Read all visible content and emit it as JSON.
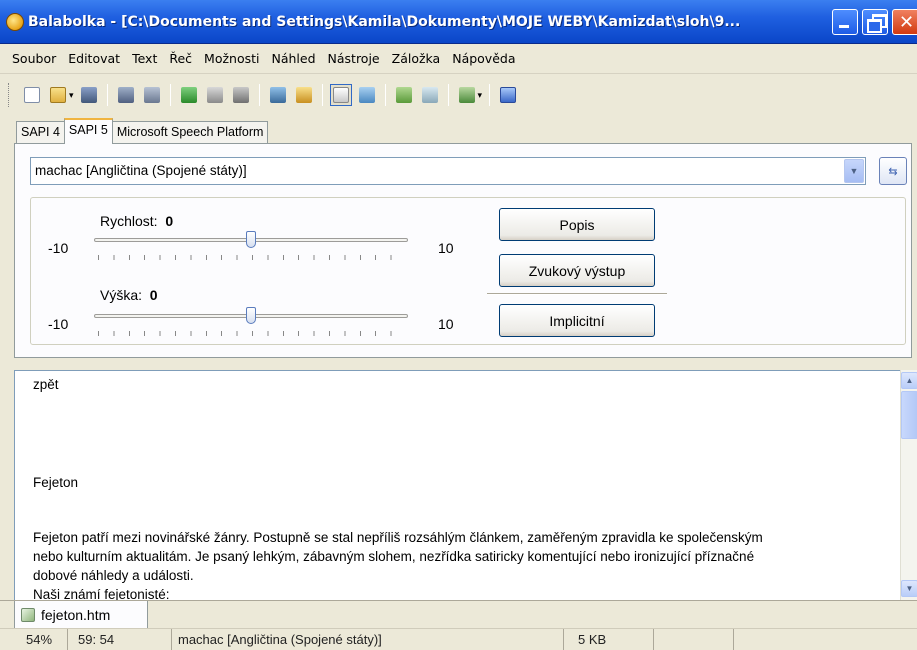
{
  "window": {
    "title": "Balabolka - [C:\\Documents and Settings\\Kamila\\Dokumenty\\MOJE WEBY\\Kamizdat\\sloh\\9...",
    "icon": "balabolka-app-icon"
  },
  "menu": [
    "Soubor",
    "Editovat",
    "Text",
    "Řeč",
    "Možnosti",
    "Náhled",
    "Nástroje",
    "Záložka",
    "Nápověda"
  ],
  "toolbar": {
    "icons": [
      "new-document-icon",
      "open-folder-icon",
      "save-icon",
      "read-aloud-icon",
      "read-clipboard-icon",
      "play-icon",
      "pause-icon",
      "stop-icon",
      "save-audio-icon",
      "open-audio-folder-icon",
      "options-icon",
      "voice-settings-icon",
      "split-file-icon",
      "batch-convert-icon",
      "bookmark-icon",
      "help-icon"
    ]
  },
  "sapi_tabs": [
    "SAPI 4",
    "SAPI 5",
    "Microsoft Speech Platform"
  ],
  "active_sapi_tab": "SAPI 5",
  "voice": {
    "selected": "machac [Angličtina (Spojené státy)]"
  },
  "rate": {
    "label": "Rychlost:",
    "value": "0",
    "min_label": "-10",
    "max_label": "10",
    "level_fraction": 0.5
  },
  "pitch": {
    "label": "Výška:",
    "value": "0",
    "min_label": "-10",
    "max_label": "10",
    "level_fraction": 0.5
  },
  "buttons": {
    "describe": "Popis",
    "audio_output": "Zvukový výstup",
    "default": "Implicitní"
  },
  "editor": {
    "lines": [
      "zpět",
      "Fejeton",
      "Fejeton patří mezi novinářské žánry. Postupně se stal nepříliš rozsáhlým článkem, zaměřeným zpravidla ke společenským",
      "nebo kulturním aktualitám. Je psaný lehkým, zábavným slohem, nezřídka satiricky komentující nebo ironizující příznačné",
      "dobové náhledy a události.",
      " Naši známí fejetonisté:"
    ]
  },
  "file_tab": {
    "name": "fejeton.htm"
  },
  "status": {
    "zoom": "54%",
    "position": "59:  54",
    "voice": "machac [Angličtina (Spojené státy)]",
    "size": "5 KB"
  },
  "colors": {
    "titlebar": "#0a46c8",
    "window_bg": "#ece9d8",
    "active_tab_accent": "#f0b440"
  }
}
